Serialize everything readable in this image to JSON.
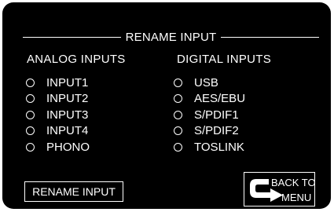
{
  "screen": {
    "title": "RENAME INPUT"
  },
  "analog": {
    "heading": "ANALOG INPUTS",
    "items": [
      {
        "label": "INPUT1"
      },
      {
        "label": "INPUT2"
      },
      {
        "label": "INPUT3"
      },
      {
        "label": "INPUT4"
      },
      {
        "label": "PHONO"
      }
    ]
  },
  "digital": {
    "heading": "DIGITAL INPUTS",
    "items": [
      {
        "label": "USB"
      },
      {
        "label": "AES/EBU"
      },
      {
        "label": "S/PDIF1"
      },
      {
        "label": "S/PDIF2"
      },
      {
        "label": "TOSLINK"
      }
    ]
  },
  "buttons": {
    "rename": "RENAME INPUT",
    "back_line1": "BACK TO",
    "back_line2": "MENU",
    "back_icon": "return-arrow-icon"
  },
  "colors": {
    "background": "#000000",
    "foreground": "#ffffff"
  }
}
